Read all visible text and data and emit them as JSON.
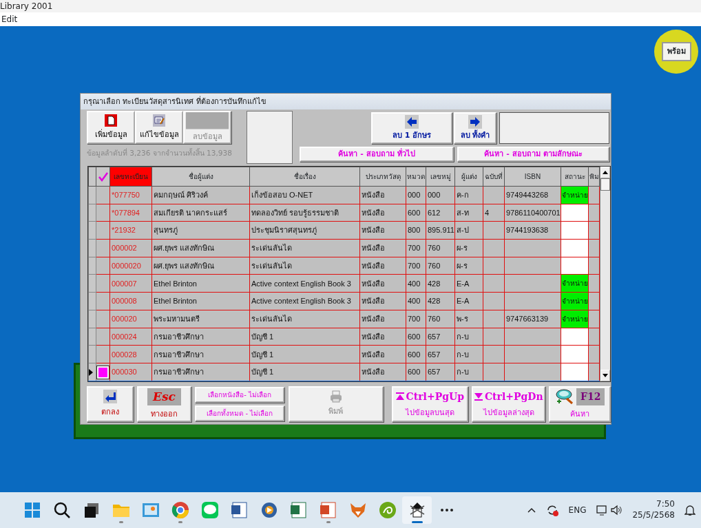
{
  "window": {
    "title": "Library 2001"
  },
  "menu": [
    "Edit"
  ],
  "status_indicator": {
    "label": "พร้อม"
  },
  "dialog": {
    "title": "กรุณาเลือก  ทะเบียนวัสดุสารนิเทศ ที่ต้องการบันทึกแก้ไข",
    "toolbar": [
      {
        "kind": "add",
        "label": "เพิ่มข้อมูล",
        "disabled": false
      },
      {
        "kind": "edit",
        "label": "แก้ไขข้อมูล",
        "disabled": false
      },
      {
        "kind": "delete",
        "label": "ลบข้อมูล",
        "disabled": true
      }
    ],
    "record_info": "ข้อมูลลำดับที่ 3,236 จากจำนวนทั้งสิ้น 13,938",
    "erase_buttons": [
      {
        "kind": "left",
        "label": "ลบ 1 อักษร"
      },
      {
        "kind": "right",
        "label": "ลบ ทั้งคำ"
      }
    ],
    "search_buttons": [
      "ค้นหา - สอบถาม ทั่วไป",
      "ค้นหา - สอบถาม ตามลักษณะ"
    ],
    "table": {
      "columns": [
        {
          "label": "เลขทะเบียน",
          "sorted": true
        },
        {
          "label": "ชื่อผู้แต่ง",
          "sorted": false
        },
        {
          "label": "ชื่อเรื่อง",
          "sorted": false
        },
        {
          "label": "ประเภทวัสดุ",
          "sorted": false
        },
        {
          "label": "หมวด",
          "sorted": false
        },
        {
          "label": "เลขหมู่",
          "sorted": false
        },
        {
          "label": "ผู้แต่ง",
          "sorted": false
        },
        {
          "label": "ฉบับที่",
          "sorted": false
        },
        {
          "label": "ISBN",
          "sorted": false
        },
        {
          "label": "สถานะ",
          "sorted": false
        },
        {
          "label": "พิม",
          "sorted": false
        }
      ],
      "rows": [
        {
          "selected": false,
          "withdrawn": true,
          "cells": [
            "*077750",
            "คมกฤษณ์  ศิริวงค์",
            "เก็งข้อสอบ O-NET",
            "หนังสือ",
            "000",
            "000",
            "ค-ก",
            "",
            "9749443268",
            "จำหน่าย"
          ]
        },
        {
          "selected": false,
          "withdrawn": false,
          "cells": [
            "*077894",
            "สมเกียรติ นาคกระแสร์",
            "ทดลองวิทย์ รอบรู้ธรรมชาติ",
            "หนังสือ",
            "600",
            "612",
            "ส-ท",
            "4",
            "9786110400701",
            ""
          ]
        },
        {
          "selected": false,
          "withdrawn": false,
          "cells": [
            "*21932",
            "สุนทรภู่",
            "ประชุมนิราศสุนทรภู่",
            "หนังสือ",
            "800",
            "895.911",
            "ส-ป",
            "",
            "9744193638",
            ""
          ]
        },
        {
          "selected": false,
          "withdrawn": false,
          "cells": [
            "000002",
            "ผศ.ยุพร แสงทักษิณ",
            "ระเด่นลันได",
            "หนังสือ",
            "700",
            "760",
            "ผ-ร",
            "",
            "",
            ""
          ]
        },
        {
          "selected": false,
          "withdrawn": false,
          "cells": [
            "0000020",
            "ผศ.ยุพร แสงทักษิณ",
            "ระเด่นลันได",
            "หนังสือ",
            "700",
            "760",
            "ผ-ร",
            "",
            "",
            ""
          ]
        },
        {
          "selected": false,
          "withdrawn": true,
          "cells": [
            "000007",
            "Ethel Brinton",
            "Active context English Book 3",
            "หนังสือ",
            "400",
            "428",
            "E-A",
            "",
            "",
            "จำหน่าย"
          ]
        },
        {
          "selected": false,
          "withdrawn": true,
          "cells": [
            "000008",
            "Ethel Brinton",
            "Active context English Book 3",
            "หนังสือ",
            "400",
            "428",
            "E-A",
            "",
            "",
            "จำหน่าย"
          ]
        },
        {
          "selected": false,
          "withdrawn": true,
          "cells": [
            "000020",
            "พระมหามนตรี",
            "ระเด่นลันได",
            "หนังสือ",
            "700",
            "760",
            "พ-ร",
            "",
            "9747663139",
            "จำหน่าย"
          ]
        },
        {
          "selected": false,
          "withdrawn": false,
          "cells": [
            "000024",
            "กรมอาชีวศึกษา",
            "บัญชี 1",
            "หนังสือ",
            "600",
            "657",
            "ก-บ",
            "",
            "",
            ""
          ]
        },
        {
          "selected": false,
          "withdrawn": false,
          "cells": [
            "000028",
            "กรมอาชีวศึกษา",
            "บัญชี 1",
            "หนังสือ",
            "600",
            "657",
            "ก-บ",
            "",
            "",
            ""
          ]
        },
        {
          "selected": true,
          "withdrawn": false,
          "cells": [
            "000030",
            "กรมอาชีวศึกษา",
            "บัญชี 1",
            "หนังสือ",
            "600",
            "657",
            "ก-บ",
            "",
            "",
            ""
          ]
        }
      ]
    },
    "bottom_buttons": [
      {
        "kind": "ok",
        "label": "ตกลง",
        "disabled": false
      },
      {
        "kind": "escape",
        "key": "Esc",
        "label": "ทางออก",
        "disabled": false
      },
      {
        "kind": "pair",
        "items": [
          "เลือกหนังสือ- ไม่เลือก",
          "เลือกทั้งหมด - ไม่เลือก"
        ]
      },
      {
        "kind": "print",
        "label": "พิมพ์",
        "disabled": true
      },
      {
        "kind": "top",
        "key": "Ctrl+PgUp",
        "label": "ไปข้อมูลบนสุด",
        "disabled": false
      },
      {
        "kind": "bottom",
        "key": "Ctrl+PgDn",
        "label": "ไปข้อมูลล่างสุด",
        "disabled": false
      },
      {
        "kind": "search",
        "key": "F12",
        "label": "ค้นหา",
        "disabled": false
      }
    ]
  },
  "taskbar": {
    "apps": [
      {
        "kind": "start",
        "running": false
      },
      {
        "kind": "search",
        "running": false
      },
      {
        "kind": "taskview",
        "running": false
      },
      {
        "kind": "folder",
        "running": true
      },
      {
        "kind": "photo",
        "running": false
      },
      {
        "kind": "browser",
        "running": true
      },
      {
        "kind": "chat",
        "running": false
      },
      {
        "kind": "word",
        "running": false
      },
      {
        "kind": "media",
        "running": false
      },
      {
        "kind": "sheet",
        "running": false
      },
      {
        "kind": "slides",
        "running": true
      },
      {
        "kind": "fox",
        "running": false
      },
      {
        "kind": "swirl",
        "running": false
      },
      {
        "kind": "library",
        "running": true
      },
      {
        "kind": "more",
        "running": false
      }
    ],
    "language": "ENG",
    "time": "7:50",
    "date": "25/5/2568"
  }
}
